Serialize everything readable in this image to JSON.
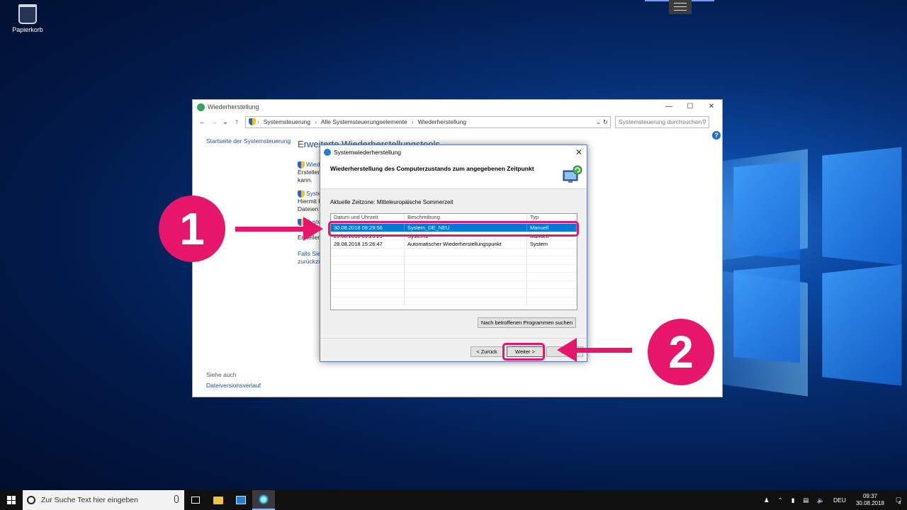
{
  "desktop": {
    "icons": [
      {
        "label": "Papierkorb",
        "icon": "recycle-bin-icon"
      }
    ]
  },
  "control_panel": {
    "title": "Wiederherstellung",
    "breadcrumb": [
      "Systemsteuerung",
      "Alle Systemsteuerungselemente",
      "Wiederherstellung"
    ],
    "search_placeholder": "Systemsteuerung durchsuchen",
    "side_link": "Startseite der Systemsteuerung",
    "heading": "Erweiterte Wiederherstellungstools",
    "items": [
      {
        "link": "Wied",
        "line1": "Erstellen",
        "line2": "kann."
      },
      {
        "link": "Syste",
        "line1": "Hiermit k",
        "line2": "Dateien u"
      },
      {
        "link": "Syste",
        "line1": "Wenn",
        "line2": "Erstellen"
      }
    ],
    "footer_link_1": "Falls Sie l",
    "footer_link_2": "zurückzu",
    "see_also": "Siehe auch",
    "file_history": "Dateiversionsverlauf"
  },
  "dialog": {
    "title": "Systemwiederherstellung",
    "header": "Wiederherstellung des Computerzustands zum angegebenen Zeitpunkt",
    "timezone": "Aktuelle Zeitzone: Mitteleuropäische Sommerzeit",
    "columns": [
      "Datum und Uhrzeit",
      "Beschreibung",
      "Typ"
    ],
    "rows": [
      {
        "date": "30.08.2018 09:29:56",
        "desc": "System_DE_NEU",
        "type": "Manuell",
        "selected": true
      },
      {
        "date": "29.08.2018 09:29:29",
        "desc": "System1",
        "type": "Manuell",
        "selected": false
      },
      {
        "date": "28.08.2018 15:26:47",
        "desc": "Automatischer Wiederherstellungspunkt",
        "type": "System",
        "selected": false
      }
    ],
    "scan_button": "Nach betroffenen Programmen suchen",
    "back_button": "< Zurück",
    "next_button": "Weiter >",
    "cancel_button": "Ab"
  },
  "annotations": {
    "badge_1": "1",
    "badge_2": "2",
    "accent": "#e6176b"
  },
  "taskbar": {
    "search_placeholder": "Zur Suche Text hier eingeben",
    "language": "DEU",
    "time": "09:37",
    "date": "30.08.2018",
    "notification_count": "4"
  }
}
